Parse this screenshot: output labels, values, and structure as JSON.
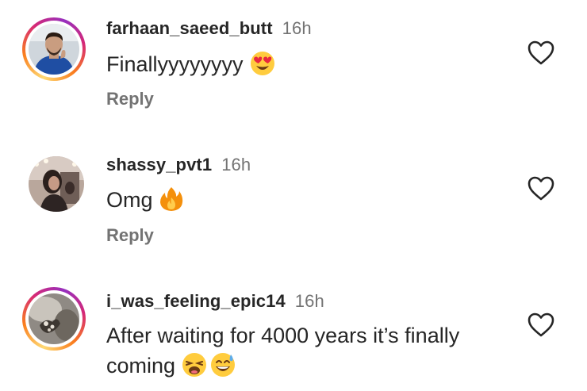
{
  "comments": [
    {
      "username": "farhaan_saeed_butt",
      "time": "16h",
      "text": "Finallyyyyyyyy",
      "emojis": [
        "heart-eyes-emoji"
      ],
      "reply_label": "Reply"
    },
    {
      "username": "shassy_pvt1",
      "time": "16h",
      "text": "Omg",
      "emojis": [
        "fire-emoji"
      ],
      "reply_label": "Reply"
    },
    {
      "username": "i_was_feeling_epic14",
      "time": "16h",
      "text_line1": "After waiting for 4000 years it’s finally",
      "text_line2": "coming",
      "emojis": [
        "weary-face-emoji",
        "grinning-sweat-emoji"
      ]
    }
  ],
  "colors": {
    "text": "#262626",
    "secondary": "#737373",
    "story_ring": [
      "#feda75",
      "#fa7e1e",
      "#d62976",
      "#962fbf"
    ]
  }
}
